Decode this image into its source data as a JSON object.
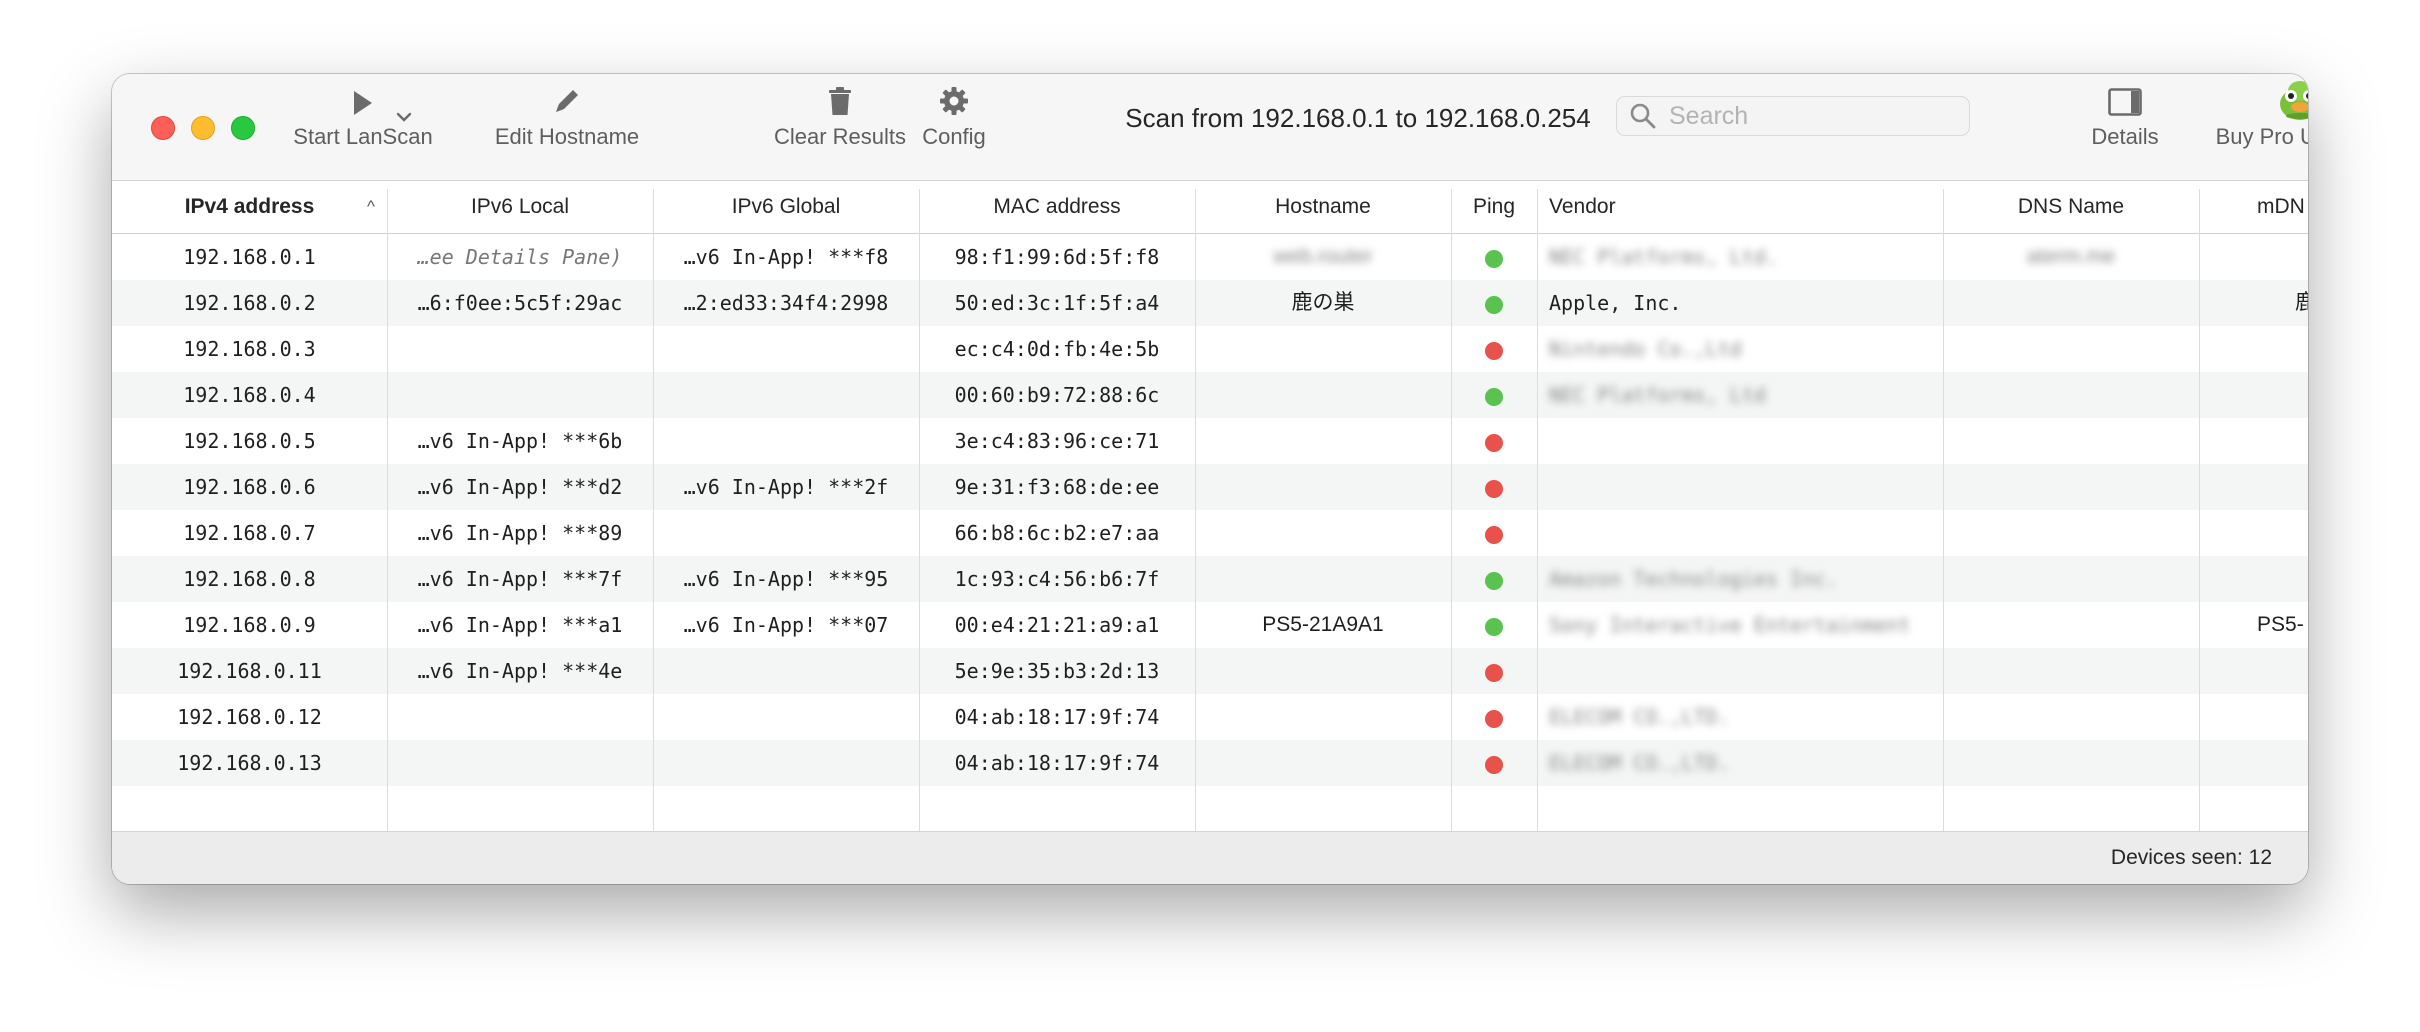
{
  "window": {
    "title": "Scan from 192.168.0.1 to 192.168.0.254"
  },
  "toolbar": {
    "start_label": "Start LanScan",
    "edit_label": "Edit Hostname",
    "clear_label": "Clear Results",
    "config_label": "Config",
    "details_label": "Details",
    "upgrade_label": "Buy Pro Upgrade"
  },
  "search": {
    "placeholder": "Search",
    "value": ""
  },
  "table": {
    "headers": {
      "ipv4": "IPv4 address",
      "ipv6_local": "IPv6 Local",
      "ipv6_global": "IPv6 Global",
      "mac": "MAC address",
      "hostname": "Hostname",
      "ping": "Ping",
      "vendor": "Vendor",
      "dns": "DNS Name",
      "mdns": "mDN"
    },
    "sort_indicator": "^",
    "rows": [
      {
        "ipv4": "192.168.0.1",
        "ipv6_local": "…ee Details Pane)",
        "ipv6_global": "…v6 In-App! ***f8",
        "mac": "98:f1:99:6d:5f:f8",
        "hostname": "web.router",
        "ping": "green",
        "vendor": "NEC Platforms, Ltd.",
        "dns": "aterm.me",
        "mdns": ""
      },
      {
        "ipv4": "192.168.0.2",
        "ipv6_local": "…6:f0ee:5c5f:29ac",
        "ipv6_global": "…2:ed33:34f4:2998",
        "mac": "50:ed:3c:1f:5f:a4",
        "hostname": "鹿の巣",
        "ping": "green",
        "vendor": "Apple, Inc.",
        "dns": "",
        "mdns": "鹿"
      },
      {
        "ipv4": "192.168.0.3",
        "ipv6_local": "",
        "ipv6_global": "",
        "mac": "ec:c4:0d:fb:4e:5b",
        "hostname": "",
        "ping": "red",
        "vendor": "Nintendo Co.,Ltd",
        "dns": "",
        "mdns": ""
      },
      {
        "ipv4": "192.168.0.4",
        "ipv6_local": "",
        "ipv6_global": "",
        "mac": "00:60:b9:72:88:6c",
        "hostname": "",
        "ping": "green",
        "vendor": "NEC Platforms, Ltd",
        "dns": "",
        "mdns": ""
      },
      {
        "ipv4": "192.168.0.5",
        "ipv6_local": "…v6 In-App! ***6b",
        "ipv6_global": "",
        "mac": "3e:c4:83:96:ce:71",
        "hostname": "",
        "ping": "red",
        "vendor": "",
        "dns": "",
        "mdns": ""
      },
      {
        "ipv4": "192.168.0.6",
        "ipv6_local": "…v6 In-App! ***d2",
        "ipv6_global": "…v6 In-App! ***2f",
        "mac": "9e:31:f3:68:de:ee",
        "hostname": "",
        "ping": "red",
        "vendor": "",
        "dns": "",
        "mdns": ""
      },
      {
        "ipv4": "192.168.0.7",
        "ipv6_local": "…v6 In-App! ***89",
        "ipv6_global": "",
        "mac": "66:b8:6c:b2:e7:aa",
        "hostname": "",
        "ping": "red",
        "vendor": "",
        "dns": "",
        "mdns": ""
      },
      {
        "ipv4": "192.168.0.8",
        "ipv6_local": "…v6 In-App! ***7f",
        "ipv6_global": "…v6 In-App! ***95",
        "mac": "1c:93:c4:56:b6:7f",
        "hostname": "",
        "ping": "green",
        "vendor": "Amazon Technologies Inc.",
        "dns": "",
        "mdns": ""
      },
      {
        "ipv4": "192.168.0.9",
        "ipv6_local": "…v6 In-App! ***a1",
        "ipv6_global": "…v6 In-App! ***07",
        "mac": "00:e4:21:21:a9:a1",
        "hostname": "PS5-21A9A1",
        "ping": "green",
        "vendor": "Sony Interactive Entertainment",
        "dns": "",
        "mdns": "PS5-"
      },
      {
        "ipv4": "192.168.0.11",
        "ipv6_local": "…v6 In-App! ***4e",
        "ipv6_global": "",
        "mac": "5e:9e:35:b3:2d:13",
        "hostname": "",
        "ping": "red",
        "vendor": "",
        "dns": "",
        "mdns": ""
      },
      {
        "ipv4": "192.168.0.12",
        "ipv6_local": "",
        "ipv6_global": "",
        "mac": "04:ab:18:17:9f:74",
        "hostname": "",
        "ping": "red",
        "vendor": "ELECOM CO.,LTD.",
        "dns": "",
        "mdns": ""
      },
      {
        "ipv4": "192.168.0.13",
        "ipv6_local": "",
        "ipv6_global": "",
        "mac": "04:ab:18:17:9f:74",
        "hostname": "",
        "ping": "red",
        "vendor": "ELECOM CO.,LTD.",
        "dns": "",
        "mdns": ""
      }
    ]
  },
  "status": {
    "devices_seen": "Devices seen: 12"
  },
  "colors": {
    "ping_up": "#5ac34f",
    "ping_down": "#e8524b",
    "close": "#ff5f57",
    "minimize": "#febc2e",
    "maximize": "#28c840"
  },
  "icons": {
    "start": "play-icon",
    "dropdown": "chevron-down-icon",
    "edit": "pencil-icon",
    "clear": "trash-icon",
    "config": "gear-icon",
    "search": "magnifier-icon",
    "details": "sidebar-icon",
    "upgrade": "mascot-icon"
  }
}
